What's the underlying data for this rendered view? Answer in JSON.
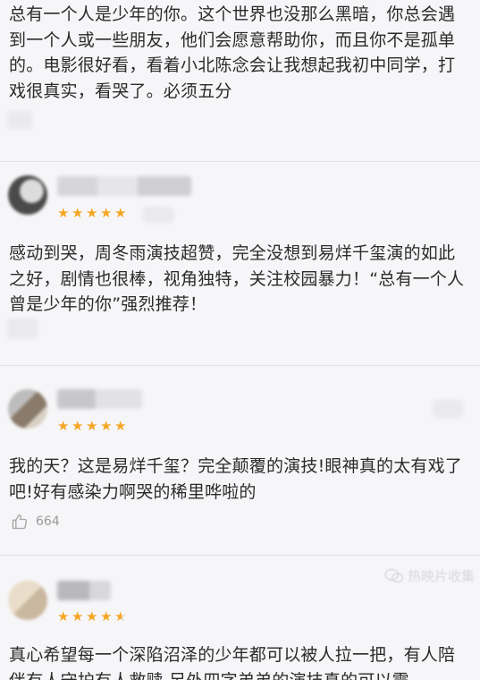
{
  "reviews": [
    {
      "text": "总有一个人是少年的你。这个世界也没那么黑暗，你总会遇到一个人或一些朋友，他们会愿意帮助你，而且你不是孤单的。电影很好看，看着小北陈念会让我想起我初中同学，打戏很真实，看哭了。必须五分"
    },
    {
      "text": "感动到哭，周冬雨演技超赞，完全没想到易烊千玺演的如此之好，剧情也很棒，视角独特，关注校园暴力！“总有一个人曾是少年的你”强烈推荐！",
      "rating": 5
    },
    {
      "text": "我的天？这是易烊千玺？完全颠覆的演技!眼神真的太有戏了吧!好有感染力啊哭的稀里哗啦的",
      "rating": 5,
      "likes": "664"
    },
    {
      "text": "真心希望每一个深陷沼泽的少年都可以被人拉一把，有人陪伴有人守护有人救赎 另外四字弟弟的演技真的可以震",
      "rating": 4.5
    }
  ],
  "watermark": "热映片收集",
  "icons": {
    "like": "thumbs-up-icon",
    "star": "star-icon",
    "wechat": "wechat-icon"
  },
  "colors": {
    "star": "#f5a623",
    "background": "#f6f6f8",
    "text": "#2b2b2b",
    "muted": "#9a9a9a"
  }
}
